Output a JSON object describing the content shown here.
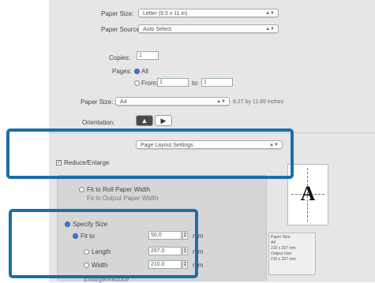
{
  "paper": {
    "size_label": "Paper Size:",
    "size_value": "Letter (8.5 x 11 in)",
    "source_label": "Paper Source:",
    "source_value": "Auto Select"
  },
  "copies": {
    "label": "Copies:",
    "value": "1"
  },
  "pages": {
    "label": "Pages:",
    "all_label": "All",
    "from_label": "From:",
    "from_value": "1",
    "to_label": "to:",
    "to_value": "1"
  },
  "scale": {
    "label": "Paper Size:",
    "value": "A4",
    "sub": "8.27 by 11.69 inches"
  },
  "orientation": {
    "label": "Orientation:"
  },
  "settings_popup": {
    "value": "Page Layout Settings"
  },
  "reduce_enlarge": {
    "label": "Reduce/Enlarge",
    "checked": true
  },
  "fit_to_page": {
    "label": "Fit to Roll Paper Width",
    "sub": "Fit to Output Paper Width"
  },
  "specify_size": {
    "label": "Specify Size",
    "fit_label": "Fit to",
    "fit_value": "50.0",
    "fit_unit": "mm",
    "length_label": "Length",
    "length_value": "297.0",
    "length_unit": "mm",
    "width_label": "Width",
    "width_value": "210.0",
    "width_unit": "mm"
  },
  "preview": {
    "letter": "A"
  },
  "info": {
    "line1": "Paper Size:",
    "line2": "A4",
    "line3": "210 x 297 mm",
    "line4": "Output Size:",
    "line5": "210 x 297 mm"
  },
  "footer": {
    "label": "Enlarge/Reduce"
  }
}
